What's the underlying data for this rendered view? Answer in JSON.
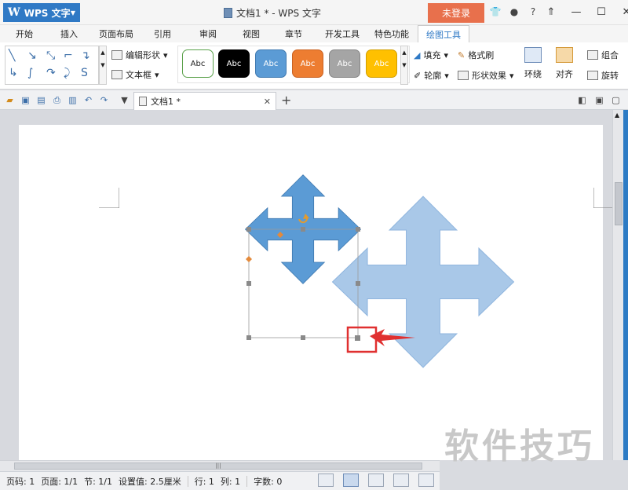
{
  "app": {
    "name": "WPS 文字",
    "logo": "W"
  },
  "window": {
    "title": "文档1 * - WPS 文字",
    "login_label": "未登录"
  },
  "title_icons": [
    "shirt-icon",
    "chat-icon",
    "help-icon",
    "panel-icon"
  ],
  "tabs": [
    "开始",
    "插入",
    "页面布局",
    "引用",
    "审阅",
    "视图",
    "章节",
    "开发工具",
    "特色功能",
    "绘图工具"
  ],
  "active_tab": "绘图工具",
  "ribbon": {
    "edit_shape": "编辑形状",
    "text_box": "文本框",
    "styles": [
      {
        "label": "Abc",
        "bg": "#ffffff",
        "border": "#5aa14a",
        "color": "#222222"
      },
      {
        "label": "Abc",
        "bg": "#000000",
        "border": "#000000",
        "color": "#ffffff"
      },
      {
        "label": "Abc",
        "bg": "#5b9bd5",
        "border": "#3f79b0",
        "color": "#ffffff"
      },
      {
        "label": "Abc",
        "bg": "#ed7d31",
        "border": "#c96222",
        "color": "#ffffff"
      },
      {
        "label": "Abc",
        "bg": "#a5a5a5",
        "border": "#858585",
        "color": "#ffffff"
      },
      {
        "label": "Abc",
        "bg": "#ffc000",
        "border": "#d19e00",
        "color": "#ffffff"
      }
    ],
    "fill": "填充",
    "format_painter": "格式刷",
    "outline": "轮廓",
    "shape_effects": "形状效果",
    "wrap": "环绕",
    "align": "对齐",
    "group": "组合",
    "rotate": "旋转"
  },
  "doc_tab": {
    "label": "文档1 *"
  },
  "status": {
    "page": "页码: 1",
    "pages": "页面: 1/1",
    "section": "节: 1/1",
    "setting": "设置值: 2.5厘米",
    "row": "行: 1",
    "col": "列: 1",
    "words": "字数: 0"
  },
  "watermark": "软件技巧",
  "colors": {
    "accent": "#2f79c5",
    "login": "#e8704c",
    "shape_selected": "#5b9bd5",
    "shape_copy": "#a9c8e8",
    "highlight": "#e03030"
  }
}
